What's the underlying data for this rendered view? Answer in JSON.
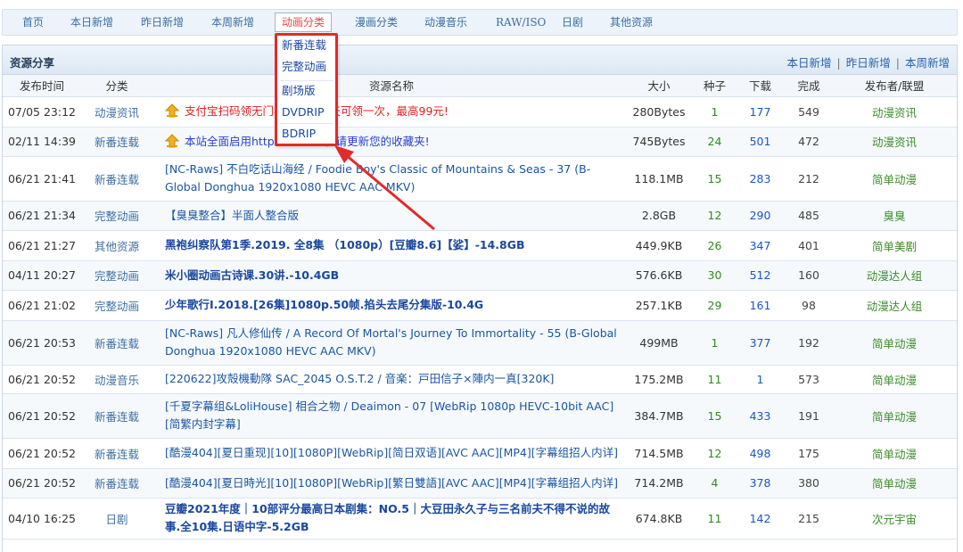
{
  "nav": {
    "items": [
      "首页",
      "本日新增",
      "昨日新增",
      "本周新增",
      "动画分类",
      "漫画分类",
      "动漫音乐",
      "RAW/ISO",
      "日剧",
      "其他资源"
    ],
    "active_index": 4
  },
  "dropdown": {
    "items": [
      "新番连载",
      "完整动画",
      "剧场版",
      "DVDRIP",
      "BDRIP"
    ]
  },
  "panel": {
    "title": "资源分享",
    "links": [
      "本日新增",
      "昨日新增",
      "本周新增"
    ]
  },
  "table": {
    "headers": [
      "发布时间",
      "分类",
      "",
      "资源名称",
      "大小",
      "种子",
      "下载",
      "完成",
      "发布者/联盟"
    ],
    "rows": [
      {
        "date": "07/05 23:12",
        "category": "动漫资讯",
        "name": "支付宝扫码领无门槛红包，每天可领一次，最高99元!",
        "style": "red",
        "pinned": true,
        "size": "280Bytes",
        "seeds": "1",
        "downloads": "177",
        "completed": "549",
        "publisher": "动漫资讯"
      },
      {
        "date": "02/11 14:39",
        "category": "新番连载",
        "name": "本站全面启用https安全访问，请更新您的收藏夹!",
        "style": "blue",
        "pinned": true,
        "size": "745Bytes",
        "seeds": "24",
        "downloads": "501",
        "completed": "472",
        "publisher": "动漫资讯"
      },
      {
        "date": "06/21 21:41",
        "category": "新番连载",
        "name": "[NC-Raws] 不白吃话山海经 / Foodie Boy's Classic of Mountains & Seas - 37 (B-Global Donghua 1920x1080 HEVC AAC MKV)",
        "style": "normal",
        "pinned": false,
        "size": "118.1MB",
        "seeds": "15",
        "downloads": "283",
        "completed": "212",
        "publisher": "简单动漫"
      },
      {
        "date": "06/21 21:34",
        "category": "完整动画",
        "name": "【臭臭整合】半面人整合版",
        "style": "normal",
        "pinned": false,
        "size": "2.8GB",
        "seeds": "12",
        "downloads": "290",
        "completed": "485",
        "publisher": "臭臭"
      },
      {
        "date": "06/21 21:27",
        "category": "其他资源",
        "name": "黑袍纠察队第1季.2019. 全8集 （1080p）[豆瓣8.6]【娑】-14.8GB",
        "style": "bold",
        "pinned": false,
        "size": "449.9KB",
        "seeds": "26",
        "downloads": "347",
        "completed": "401",
        "publisher": "简单美剧"
      },
      {
        "date": "04/11 20:27",
        "category": "完整动画",
        "name": "米小圈动画古诗课.30讲.-10.4GB",
        "style": "bold",
        "pinned": false,
        "size": "576.6KB",
        "seeds": "30",
        "downloads": "512",
        "completed": "160",
        "publisher": "动漫达人组"
      },
      {
        "date": "06/21 21:02",
        "category": "完整动画",
        "name": "少年歌行I.2018.[26集]1080p.50帧.掐头去尾分集版-10.4G",
        "style": "bold",
        "pinned": false,
        "size": "257.1KB",
        "seeds": "29",
        "downloads": "161",
        "completed": "98",
        "publisher": "动漫达人组"
      },
      {
        "date": "06/21 20:53",
        "category": "新番连载",
        "name": "[NC-Raws] 凡人修仙传 / A Record Of Mortal's Journey To Immortality - 55 (B-Global Donghua 1920x1080 HEVC AAC MKV)",
        "style": "normal",
        "pinned": false,
        "size": "499MB",
        "seeds": "1",
        "downloads": "377",
        "completed": "192",
        "publisher": "简单动漫"
      },
      {
        "date": "06/21 20:52",
        "category": "动漫音乐",
        "name": "[220622]攻殻機動隊 SAC_2045 O.S.T.2 / 音楽：戸田信子×陣内一真[320K]",
        "style": "normal",
        "pinned": false,
        "size": "175.2MB",
        "seeds": "11",
        "downloads": "1",
        "completed": "573",
        "publisher": "简单动漫"
      },
      {
        "date": "06/21 20:52",
        "category": "新番连载",
        "name": "[千夏字幕组&LoliHouse] 相合之物 / Deaimon - 07 [WebRip 1080p HEVC-10bit AAC][简繁内封字幕]",
        "style": "normal",
        "pinned": false,
        "size": "384.7MB",
        "seeds": "15",
        "downloads": "433",
        "completed": "191",
        "publisher": "简单动漫"
      },
      {
        "date": "06/21 20:52",
        "category": "新番连载",
        "name": "[酷漫404][夏日重现][10][1080P][WebRip][简日双语][AVC AAC][MP4][字幕组招人内详]",
        "style": "normal",
        "pinned": false,
        "size": "714.5MB",
        "seeds": "12",
        "downloads": "498",
        "completed": "175",
        "publisher": "简单动漫"
      },
      {
        "date": "06/21 20:52",
        "category": "新番连载",
        "name": "[酷漫404][夏日時光][10][1080P][WebRip][繁日雙語][AVC AAC][MP4][字幕组招人内详]",
        "style": "normal",
        "pinned": false,
        "size": "714.2MB",
        "seeds": "4",
        "downloads": "378",
        "completed": "380",
        "publisher": "简单动漫"
      },
      {
        "date": "04/10 16:25",
        "category": "日剧",
        "name": "豆瓣2021年度｜10部评分最高日本剧集：NO.5｜大豆田永久子与三名前夫不得不说的故事.全10集.日语中字-5.2GB",
        "style": "bold",
        "pinned": false,
        "size": "674.8KB",
        "seeds": "11",
        "downloads": "142",
        "completed": "215",
        "publisher": "次元宇宙"
      }
    ]
  },
  "colors": {
    "accent": "#e02b2b",
    "link": "#1a56a3",
    "seed_green": "#2e8b1e",
    "publisher_green": "#3b8a2a"
  }
}
